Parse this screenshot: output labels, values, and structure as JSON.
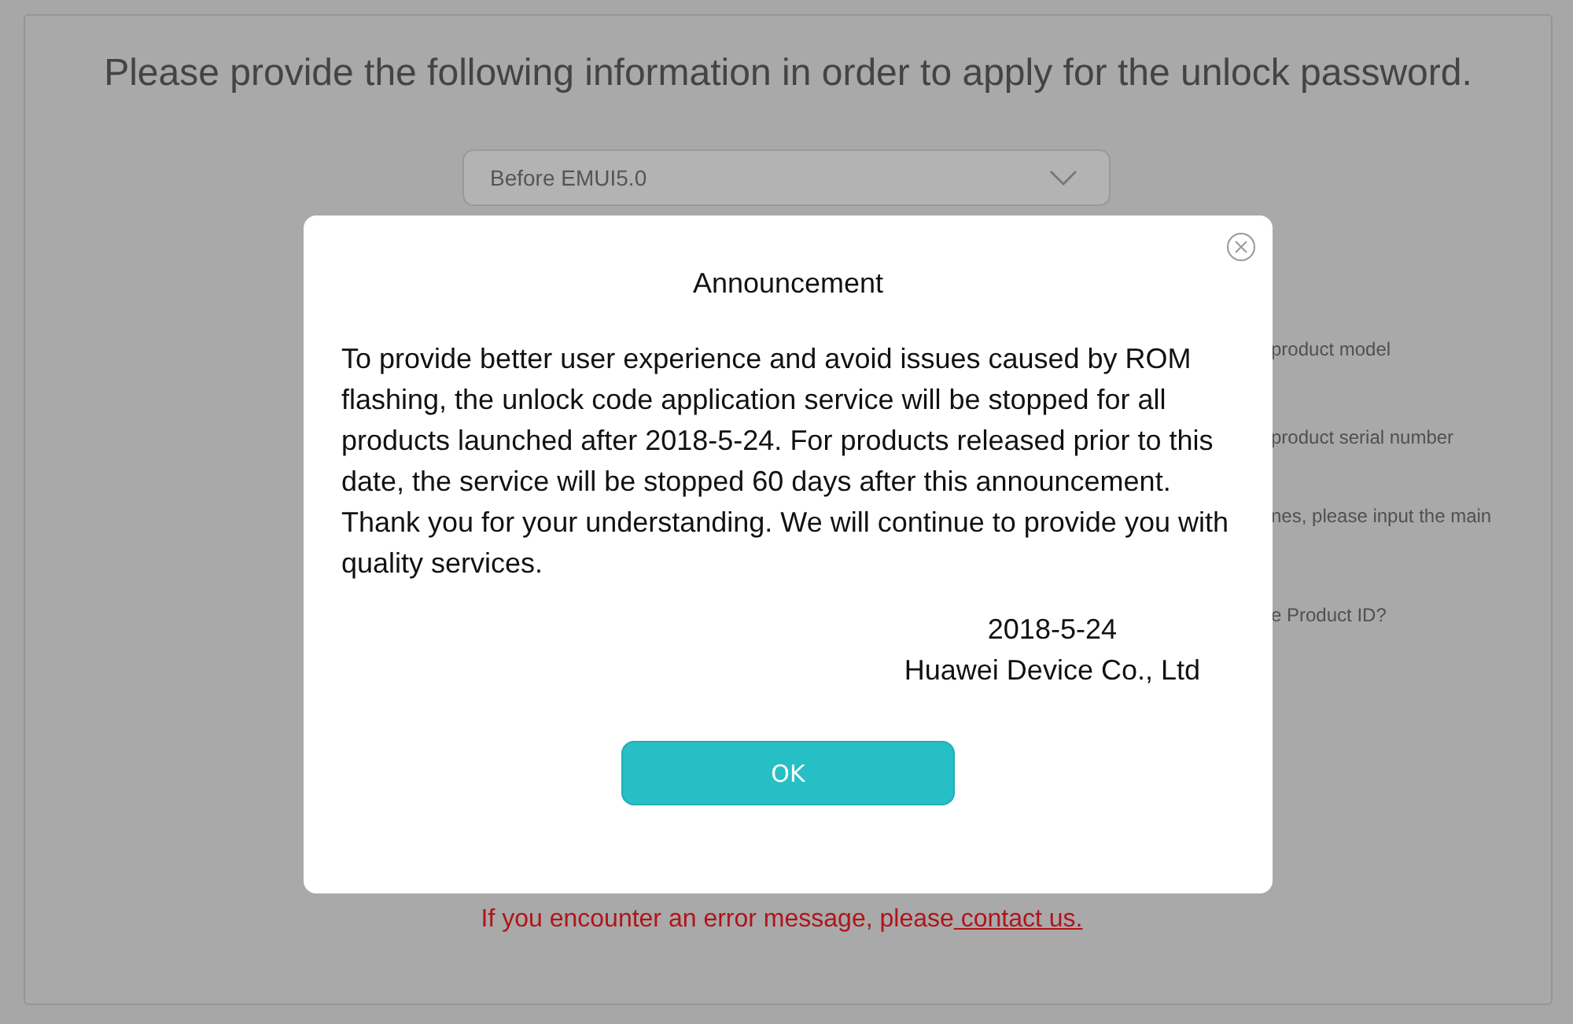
{
  "page": {
    "title": "Please provide the following information in order to apply for the unlock password.",
    "version_select": {
      "value": "Before EMUI5.0"
    },
    "hints": [
      "product model",
      "product serial number",
      "nes, please input the main",
      "e Product ID?"
    ],
    "error_note": {
      "text": "If you encounter an error message, please",
      "link": " contact us."
    }
  },
  "dialog": {
    "title": "Announcement",
    "paragraphs": [
      "To provide better user experience and avoid issues caused by ROM flashing, the unlock code application service will be stopped for all products launched after 2018-5-24. For products released prior to this date, the service will be stopped 60 days after this announcement.",
      "Thank you for your understanding. We will continue to provide you with quality services."
    ],
    "date": "2018-5-24",
    "signature": "Huawei Device Co., Ltd",
    "ok_button": "OK"
  }
}
